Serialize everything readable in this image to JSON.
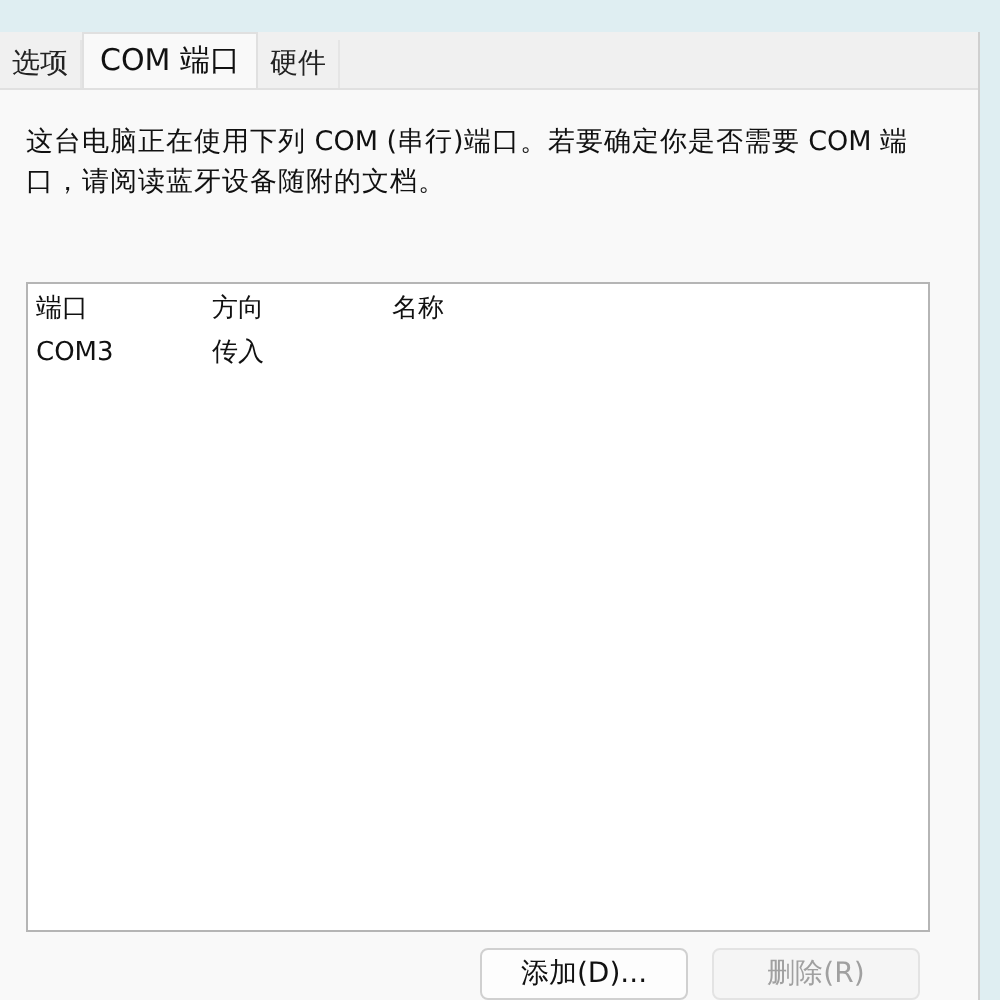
{
  "tabs": [
    {
      "label": "选项",
      "selected": false
    },
    {
      "label": "COM 端口",
      "selected": true
    },
    {
      "label": "硬件",
      "selected": false
    }
  ],
  "description": "这台电脑正在使用下列 COM (串行)端口。若要确定你是否需要 COM 端口，请阅读蓝牙设备随附的文档。",
  "table": {
    "columns": [
      "端口",
      "方向",
      "名称"
    ],
    "rows": [
      [
        "COM3",
        "传入",
        ""
      ]
    ]
  },
  "buttons": [
    {
      "label": "添加(D)...",
      "disabled": false
    },
    {
      "label": "删除(R)",
      "disabled": true
    }
  ]
}
